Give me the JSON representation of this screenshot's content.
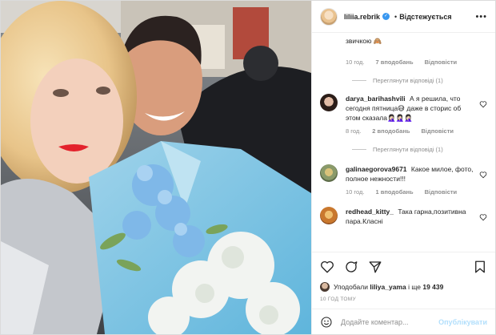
{
  "post": {
    "username": "liliia.rebrik",
    "verified_mark": "✓",
    "separator": "•",
    "follow_label": "Відстежується",
    "more_icon": "more-dots-icon"
  },
  "comments": [
    {
      "text": "звичкою 🙈",
      "time": "10 год.",
      "likes": "7 вподобань",
      "reply_label": "Відповісти",
      "view_replies": "Переглянути відповіді (1)"
    },
    {
      "user": "darya_barihashvili",
      "text": "А я решила, что сегодня пятница😅 даже в сторис об этом сказала🤦🏻‍♀️🤦🏻‍♀️🤦🏻‍♀️",
      "time": "8 год.",
      "likes": "2 вподобань",
      "reply_label": "Відповісти",
      "view_replies": "Переглянути відповіді (1)"
    },
    {
      "user": "galinaegorova9671",
      "text": "Какое милое, фото, полное нежности!!!",
      "time": "10 год.",
      "likes": "1 вподобань",
      "reply_label": "Відповісти"
    },
    {
      "user": "redhead_kitty_",
      "text": "Така гарна,позитивна пара.Класні"
    }
  ],
  "likes_bar": {
    "prefix": "Уподобали",
    "user": "liliya_yama",
    "middle": "і ще",
    "count": "19 439"
  },
  "timestamp": "10 ГОД ТОМУ",
  "composer": {
    "placeholder": "Додайте коментар...",
    "publish_label": "Опублікувати"
  },
  "colors": {
    "accent": "#3897f0",
    "publish_disabled": "#b2dffc",
    "muted": "#8e8e8e"
  }
}
